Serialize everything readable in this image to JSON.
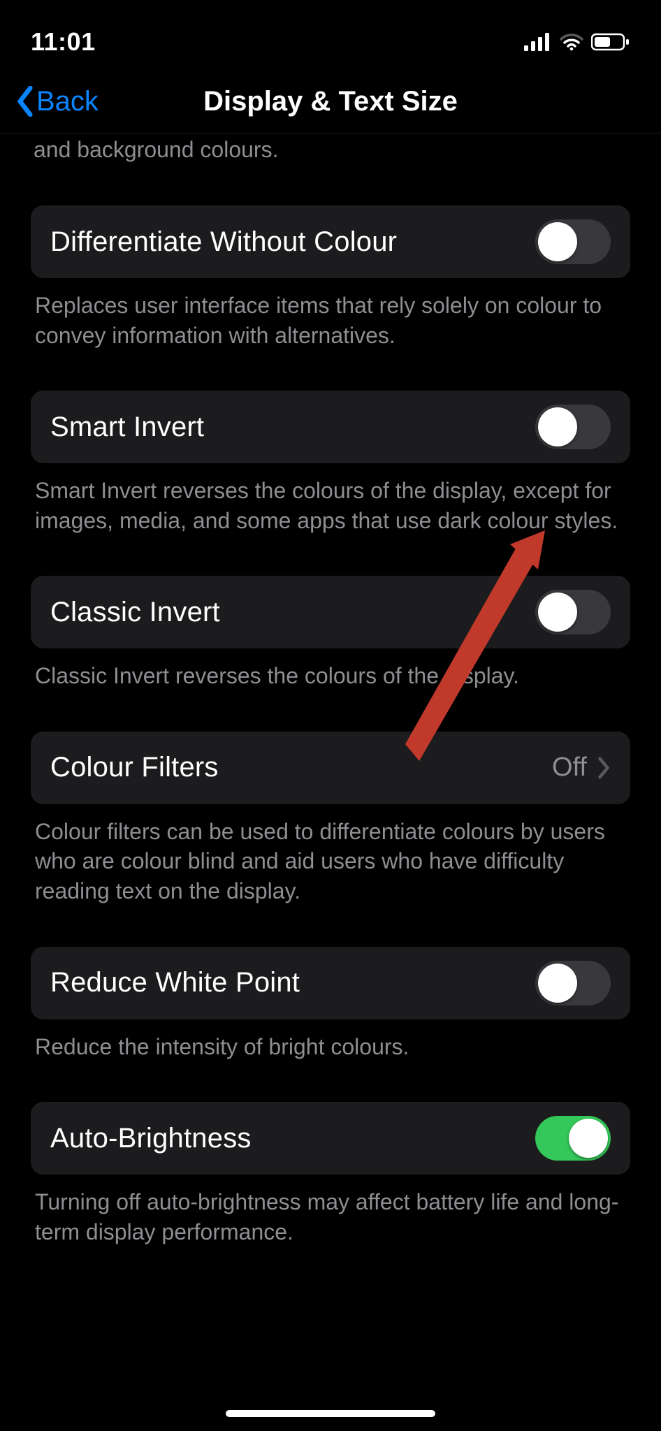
{
  "status_bar": {
    "time": "11:01"
  },
  "nav": {
    "back_label": "Back",
    "title": "Display & Text Size"
  },
  "partial_top_desc": "and background colours.",
  "groups": {
    "differentiate": {
      "label": "Differentiate Without Colour",
      "on": false,
      "desc": "Replaces user interface items that rely solely on colour to convey information with alternatives."
    },
    "smart_invert": {
      "label": "Smart Invert",
      "on": false,
      "desc": "Smart Invert reverses the colours of the display, except for images, media, and some apps that use dark colour styles."
    },
    "classic_invert": {
      "label": "Classic Invert",
      "on": false,
      "desc": "Classic Invert reverses the colours of the display."
    },
    "colour_filters": {
      "label": "Colour Filters",
      "value": "Off",
      "desc": "Colour filters can be used to differentiate colours by users who are colour blind and aid users who have difficulty reading text on the display."
    },
    "reduce_white_point": {
      "label": "Reduce White Point",
      "on": false,
      "desc": "Reduce the intensity of bright colours."
    },
    "auto_brightness": {
      "label": "Auto-Brightness",
      "on": true,
      "desc": "Turning off auto-brightness may affect battery life and long-term display performance."
    }
  }
}
